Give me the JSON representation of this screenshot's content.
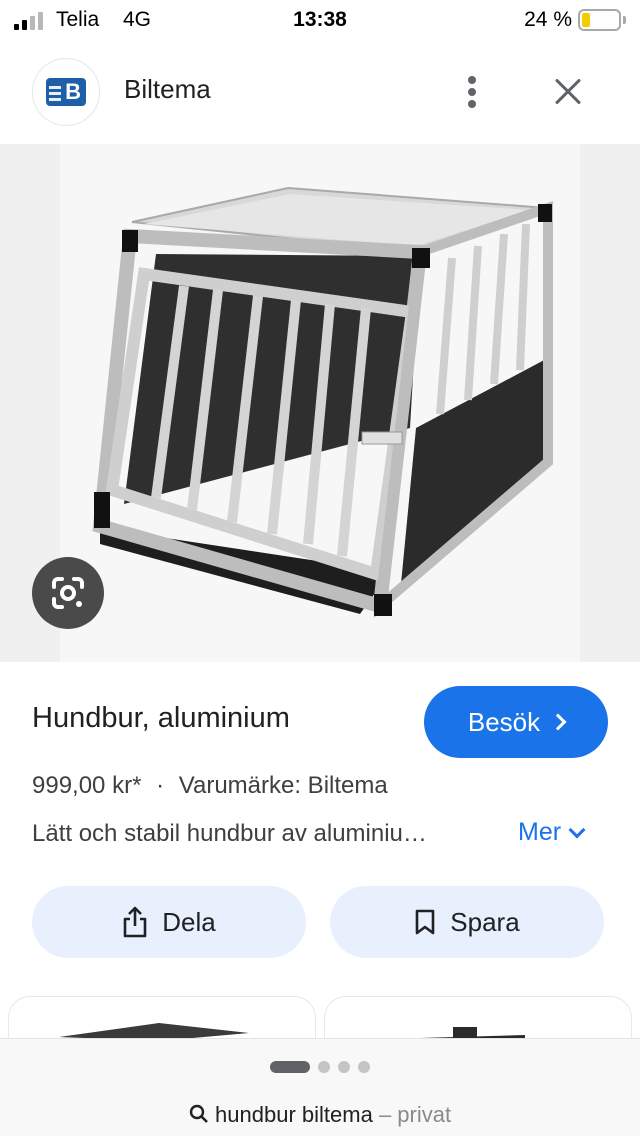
{
  "status_bar": {
    "carrier": "Telia",
    "network": "4G",
    "time": "13:38",
    "battery_percent": "24 %",
    "battery_level": 0.24
  },
  "header": {
    "site_name": "Biltema",
    "logo_letter": "B",
    "more_icon": "more-vert-icon",
    "close_icon": "close-icon"
  },
  "image": {
    "lens_icon": "google-lens-icon"
  },
  "product": {
    "title": "Hundbur, aluminium",
    "visit_label": "Besök",
    "price": "999,00 kr*",
    "separator": "·",
    "brand": "Varumärke: Biltema",
    "description": "Lätt och stabil hundbur av aluminiu…",
    "more_label": "Mer"
  },
  "actions": {
    "share_label": "Dela",
    "save_label": "Spara"
  },
  "bottom_bar": {
    "page_count": 4,
    "active_page": 1,
    "query": "hundbur biltema",
    "private_label": "– privat"
  },
  "colors": {
    "accent": "#1a73e8",
    "chip_bg": "#e8f0fe",
    "logo_blue": "#1f5fa8",
    "battery_yellow": "#f5cc00"
  }
}
